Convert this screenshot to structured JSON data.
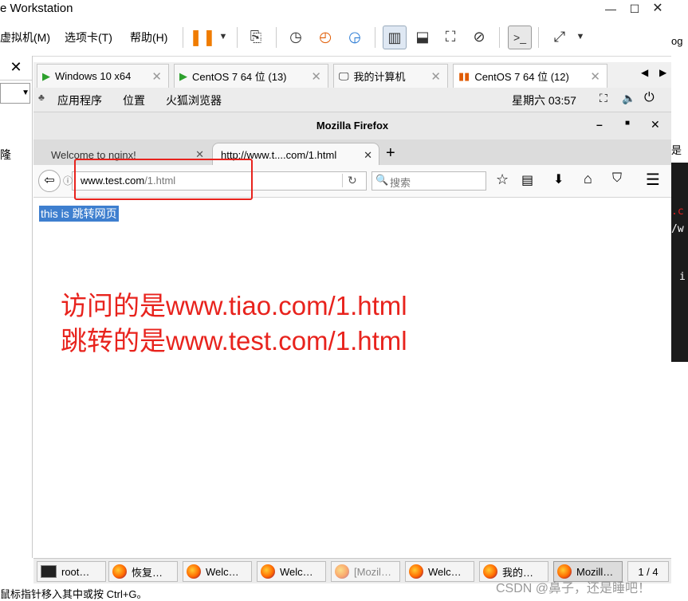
{
  "app": {
    "title": "e Workstation"
  },
  "menu": {
    "vm": "虚拟机(M)",
    "tabs": "选项卡(T)",
    "help": "帮助(H)"
  },
  "left": {
    "snippet": "隆"
  },
  "vm_tabs": [
    {
      "label": "Windows 10 x64"
    },
    {
      "label": "CentOS 7 64 位 (13)"
    },
    {
      "label": "我的计算机"
    },
    {
      "label": "CentOS 7 64 位 (12)"
    }
  ],
  "gnome": {
    "apps": "应用程序",
    "places": "位置",
    "browser": "火狐浏览器",
    "clock": "星期六 03:57"
  },
  "firefox": {
    "title": "Mozilla Firefox",
    "tabs": [
      {
        "label": "Welcome to nginx!"
      },
      {
        "label": "http://www.t....com/1.html"
      }
    ],
    "url_host": "www.test.com",
    "url_path": "/1.html",
    "search_placeholder": "搜索",
    "page_text": "this is 跳转网页"
  },
  "annotation": {
    "line1": "访问的是www.tiao.com/1.html",
    "line2": "跳转的是www.test.com/1.html",
    "color": "#e8231d"
  },
  "right_strip": {
    "l1": "og",
    "l2": "是",
    "l3": ".c",
    "l4": "/w",
    "l5": "i"
  },
  "taskbar": {
    "items": [
      {
        "label": "root…"
      },
      {
        "label": "恢复…"
      },
      {
        "label": "Welc…"
      },
      {
        "label": "Welc…"
      },
      {
        "label": "[Mozil…"
      },
      {
        "label": "Welc…"
      },
      {
        "label": "我的…"
      },
      {
        "label": "Mozill…"
      }
    ],
    "pager": "1 / 4"
  },
  "status": {
    "text": "鼠标指针移入其中或按 Ctrl+G。",
    "watermark": "CSDN @鼻子，还是睡吧！"
  }
}
